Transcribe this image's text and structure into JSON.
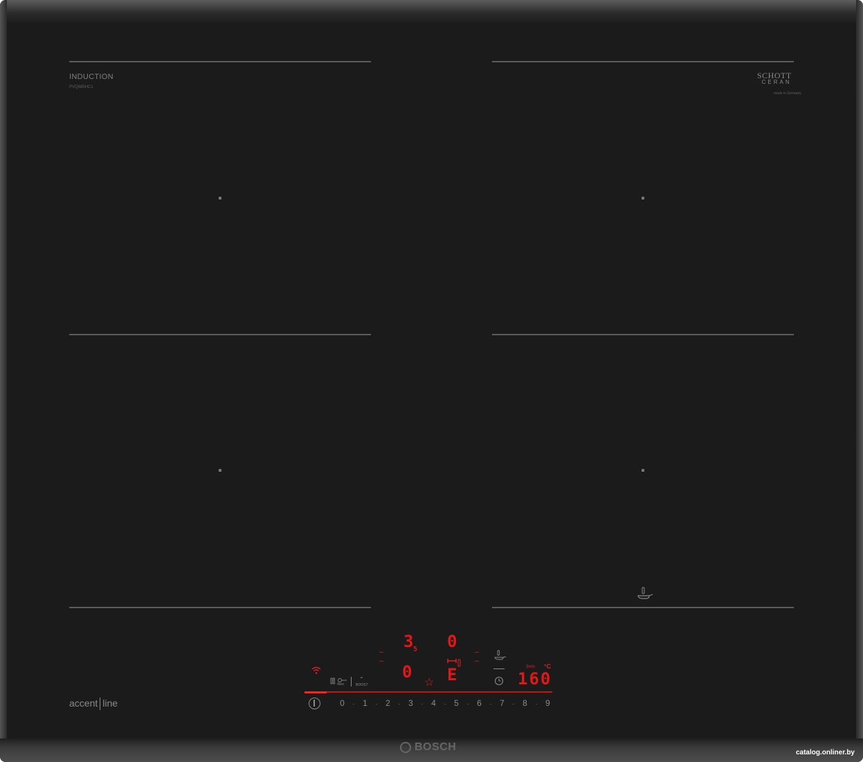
{
  "branding": {
    "type_label": "INDUCTION",
    "model_code": "PVQ685HC1",
    "glass_brand_line1": "SCHOTT",
    "glass_brand_line2": "CERAN",
    "glass_sub": "made in Germany",
    "series_part1": "accent",
    "series_part2": "line",
    "manufacturer": "BOSCH",
    "watermark": "catalog.onliner.by"
  },
  "displays": {
    "zone_top_left": "3",
    "zone_top_left_decimal": "5",
    "zone_top_right": "0",
    "zone_bottom_left": "0",
    "zone_bottom_right": "E",
    "timer_label": "3min",
    "temperature": "160",
    "temperature_unit": "°C"
  },
  "controls": {
    "lock_label": "4sec",
    "boost_label": "BOOST",
    "power_scale": [
      "0",
      "1",
      "2",
      "3",
      "4",
      "5",
      "6",
      "7",
      "8",
      "9"
    ]
  },
  "colors": {
    "glass": "#1b1b1b",
    "display_red": "#e01818",
    "zone_lines": "#5c5c5c",
    "print_grey": "#8a8a8a"
  },
  "icons": [
    "wifi-icon",
    "child-lock-icon",
    "boost-icon",
    "favourite-star-icon",
    "frying-sensor-icon",
    "clock-icon",
    "power-icon",
    "bosch-logo-icon"
  ]
}
